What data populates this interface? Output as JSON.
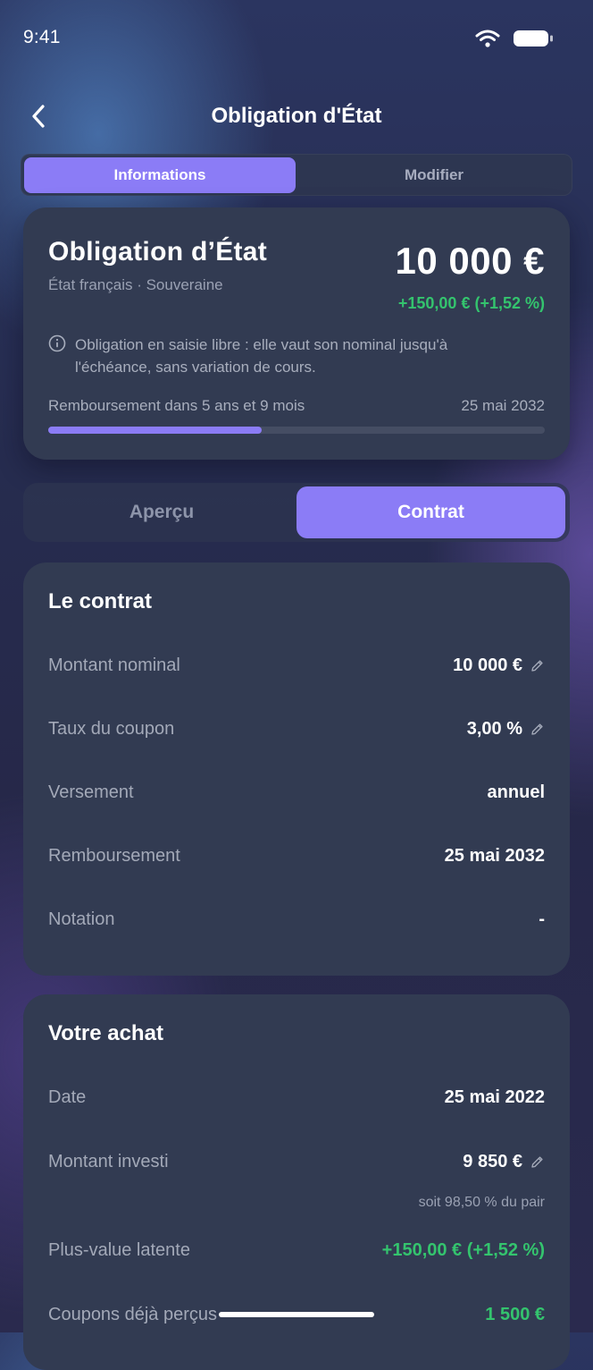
{
  "status_bar": {
    "time": "9:41"
  },
  "header": {
    "title": "Obligation d'État"
  },
  "top_tabs": {
    "active": "Informations",
    "inactive": "Modifier"
  },
  "summary": {
    "name": "Obligation d’État",
    "subtitle": "État français · Souveraine",
    "value": "10 000 €",
    "change": "+150,00 € (+1,52 %)",
    "info": "Obligation en saisie libre : elle vaut son nominal jusqu'à l'échéance, sans variation de cours.",
    "repayment_label": "Remboursement dans 5 ans et 9 mois",
    "repayment_date": "25 mai 2032",
    "progress": 0.43
  },
  "view_tabs": {
    "overview": "Aperçu",
    "contract": "Contrat"
  },
  "contract": {
    "title": "Le contrat",
    "rows": [
      {
        "label": "Montant nominal",
        "value": "10 000 €"
      },
      {
        "label": "Taux du coupon",
        "value": "3,00 %"
      },
      {
        "label": "Versement",
        "value": "annuel"
      },
      {
        "label": "Remboursement",
        "value": "25 mai 2032"
      },
      {
        "label": "Notation",
        "value": "-"
      }
    ]
  },
  "purchase": {
    "title": "Votre achat",
    "rows": [
      {
        "label": "Date",
        "value": "25 mai 2022"
      },
      {
        "label": "Montant investi",
        "value": "9 850 €",
        "note": "soit 98,50 % du pair"
      },
      {
        "label": "Plus-value latente",
        "value": "+150,00 € (+1,52 %)"
      },
      {
        "label": "Coupons déjà perçus",
        "value": "1 500 €"
      }
    ]
  },
  "colors": {
    "accent": "#8b7cf6",
    "positive": "#34c46e",
    "card": "#323b52"
  },
  "icons": [
    "back-chevron-icon",
    "wifi-icon",
    "battery-icon",
    "info-icon",
    "pencil-icon"
  ]
}
